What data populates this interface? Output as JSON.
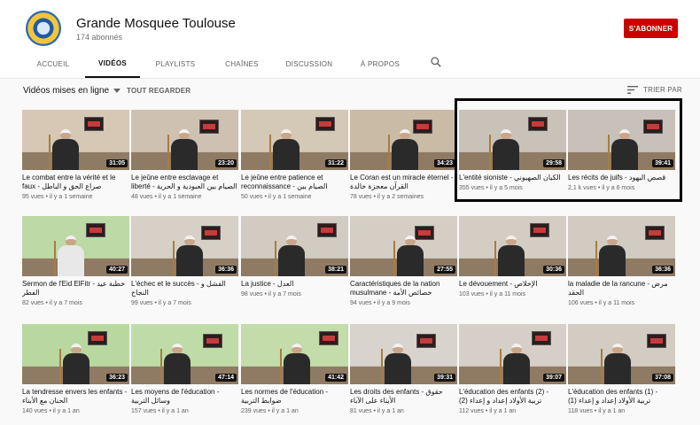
{
  "channel": {
    "name": "Grande Mosquee Toulouse",
    "subscribers": "174 abonnés",
    "subscribe_label": "S'ABONNER"
  },
  "tabs": [
    {
      "label": "ACCUEIL"
    },
    {
      "label": "VIDÉOS"
    },
    {
      "label": "PLAYLISTS"
    },
    {
      "label": "CHAÎNES"
    },
    {
      "label": "DISCUSSION"
    },
    {
      "label": "À PROPOS"
    }
  ],
  "toolbar": {
    "filter_label": "Vidéos mises en ligne",
    "play_all": "TOUT REGARDER",
    "sort_label": "TRIER PAR"
  },
  "colors": {
    "accent": "#cc0000",
    "highlight_border": "#000000"
  },
  "videos": [
    {
      "title": "Le combat entre la vérité et le faux - صراع الحق و الباطل",
      "meta": "95 vues • il y a 1 semaine",
      "duration": "31:05",
      "wall": "#d7c7b5",
      "person": "dark"
    },
    {
      "title": "Le jeûne entre esclavage et liberté - الصيام بين العبودية و الحرية",
      "meta": "48 vues • il y a 1 semaine",
      "duration": "23:20",
      "wall": "#cfc1b1",
      "person": "dark"
    },
    {
      "title": "Le jeûne entre patience et reconnaissance - الصيام بين",
      "meta": "50 vues • il y a 1 semaine",
      "duration": "31:22",
      "wall": "#d4c8b7",
      "person": "dark"
    },
    {
      "title": "Le Coran est un miracle éternel - القرآن معجزة خالدة",
      "meta": "78 vues • il y a 2 semaines",
      "duration": "34:23",
      "wall": "#cabba7",
      "person": "dark"
    },
    {
      "title": "L'entité sioniste - الكيان الصهيوني",
      "meta": "355 vues • il y a 5 mois",
      "duration": "29:58",
      "wall": "#c9c2b9",
      "person": "dark"
    },
    {
      "title": "Les récits de juifs - قصص اليهود",
      "meta": "2,1 k vues • il y a 6 mois",
      "duration": "39:41",
      "wall": "#c7c1ba",
      "person": "dark"
    },
    {
      "title": "Sermon de l'Eid ElFitr - خطبة عيد الفطر",
      "meta": "82 vues • il y a 7 mois",
      "duration": "40:27",
      "wall": "#bcd9a6",
      "person": "white"
    },
    {
      "title": "L'échec et le succès - الفشل و النجاح",
      "meta": "99 vues • il y a 7 mois",
      "duration": "36:36",
      "wall": "#d6d0c6",
      "person": "dark"
    },
    {
      "title": "La justice - العدل",
      "meta": "98 vues • il y a 7 mois",
      "duration": "38:21",
      "wall": "#d2cbc1",
      "person": "dark"
    },
    {
      "title": "Caractéristiques de la nation musulmane - خصائص الأمة",
      "meta": "94 vues • il y a 9 mois",
      "duration": "27:55",
      "wall": "#d4cec5",
      "person": "dark"
    },
    {
      "title": "Le dévouement - الإخلاص",
      "meta": "103 vues • il y a 11 mois",
      "duration": "30:36",
      "wall": "#d3cdc4",
      "person": "dark"
    },
    {
      "title": "la maladie de la rancune - مرض الحقد",
      "meta": "106 vues • il y a 11 mois",
      "duration": "36:36",
      "wall": "#d1cbc2",
      "person": "dark"
    },
    {
      "title": "La tendresse envers les enfants - الحنان مع الأبناء",
      "meta": "140 vues • il y a 1 an",
      "duration": "36:23",
      "wall": "#b8d89f",
      "person": "dark"
    },
    {
      "title": "Les moyens de l'éducation - وسائل التربية",
      "meta": "157 vues • il y a 1 an",
      "duration": "47:14",
      "wall": "#bfdca8",
      "person": "dark"
    },
    {
      "title": "Les normes de l'éducation - ضوابط التربية",
      "meta": "239 vues • il y a 1 an",
      "duration": "41:42",
      "wall": "#c3dcaa",
      "person": "dark"
    },
    {
      "title": "Les droits des enfants - حقوق الأبناء على الآباء",
      "meta": "81 vues • il y a 1 an",
      "duration": "39:31",
      "wall": "#d8d3cc",
      "person": "dark"
    },
    {
      "title": "L'éducation des enfants (2) - (تربية الأولاد إعداد و إعداء (2",
      "meta": "112 vues • il y a 1 an",
      "duration": "39:07",
      "wall": "#d5cfc7",
      "person": "dark"
    },
    {
      "title": "L'éducation des enfants (1) - (تربية الأولاد إعداد و إعداء (1",
      "meta": "118 vues • il y a 1 an",
      "duration": "37:08",
      "wall": "#d2ccc3",
      "person": "dark"
    }
  ]
}
